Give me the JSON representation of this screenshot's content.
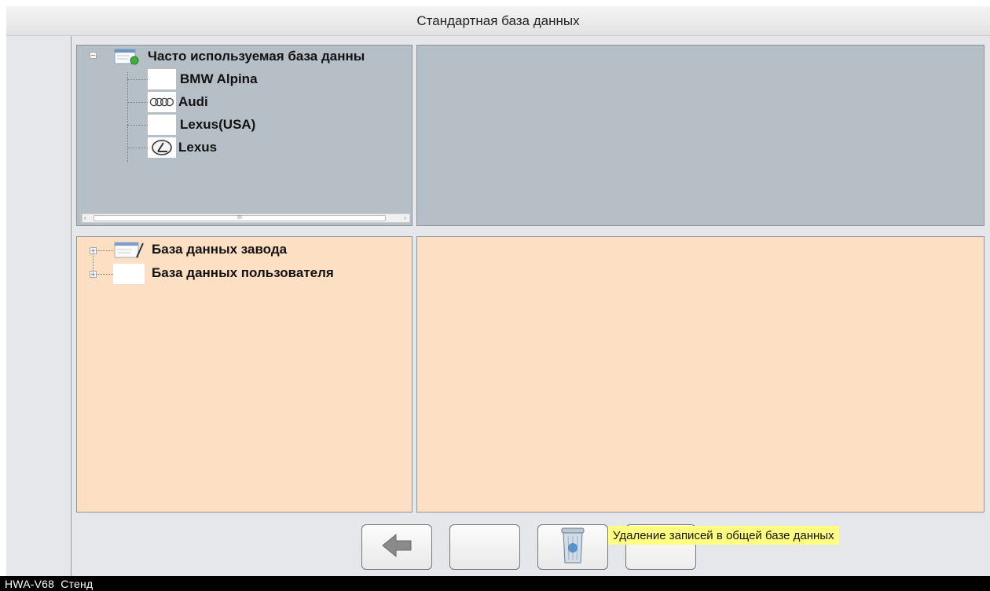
{
  "window": {
    "title": "Стандартная база данных"
  },
  "top_tree": {
    "root_label": "Часто используемая база данны",
    "items": [
      {
        "label": "BMW Alpina",
        "logo": "none"
      },
      {
        "label": "Audi",
        "logo": "audi-rings-icon"
      },
      {
        "label": "Lexus(USA)",
        "logo": "none"
      },
      {
        "label": "Lexus",
        "logo": "lexus-emblem-icon"
      }
    ],
    "scrollbar_thumb_mark": "III"
  },
  "bottom_tree": {
    "items": [
      {
        "label": "База данных завода"
      },
      {
        "label": "База данных пользователя"
      }
    ]
  },
  "toolbar": {
    "back_icon": "arrow-left-icon",
    "delete_icon": "trash-bin-icon",
    "tooltip": "Удаление записей в общей базе данных"
  },
  "status_bar": {
    "text": "HWA-V68  Стенд"
  },
  "colors": {
    "top_panel": "#b6bfc6",
    "bottom_panel": "#fde0c3",
    "tooltip": "#ffff80",
    "status_bar": "#000000"
  }
}
